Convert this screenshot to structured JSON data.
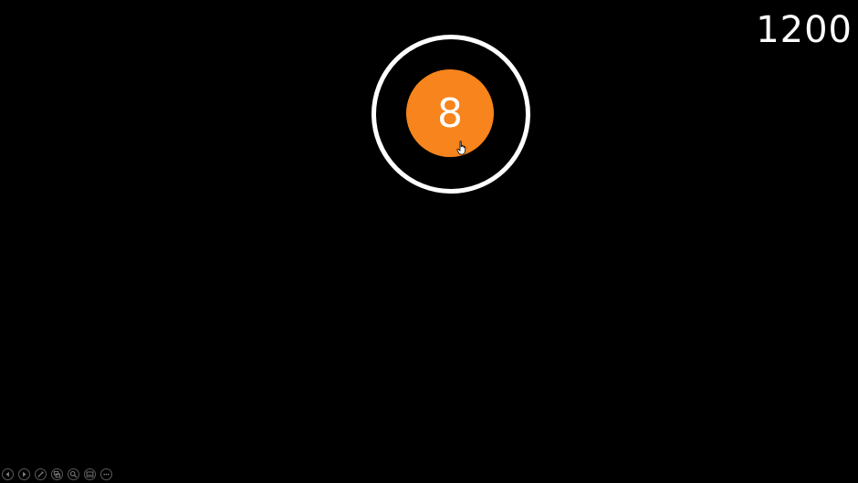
{
  "slide": {
    "score": "1200",
    "target_number": "8",
    "target_color": "#F7841C",
    "ring_color": "#FFFFFF",
    "background_color": "#000000"
  },
  "toolbar": {
    "buttons": [
      {
        "icon": "previous-icon"
      },
      {
        "icon": "next-icon"
      },
      {
        "icon": "pen-icon"
      },
      {
        "icon": "slides-grid-icon"
      },
      {
        "icon": "zoom-icon"
      },
      {
        "icon": "subtitles-icon"
      },
      {
        "icon": "more-options-icon"
      }
    ]
  }
}
